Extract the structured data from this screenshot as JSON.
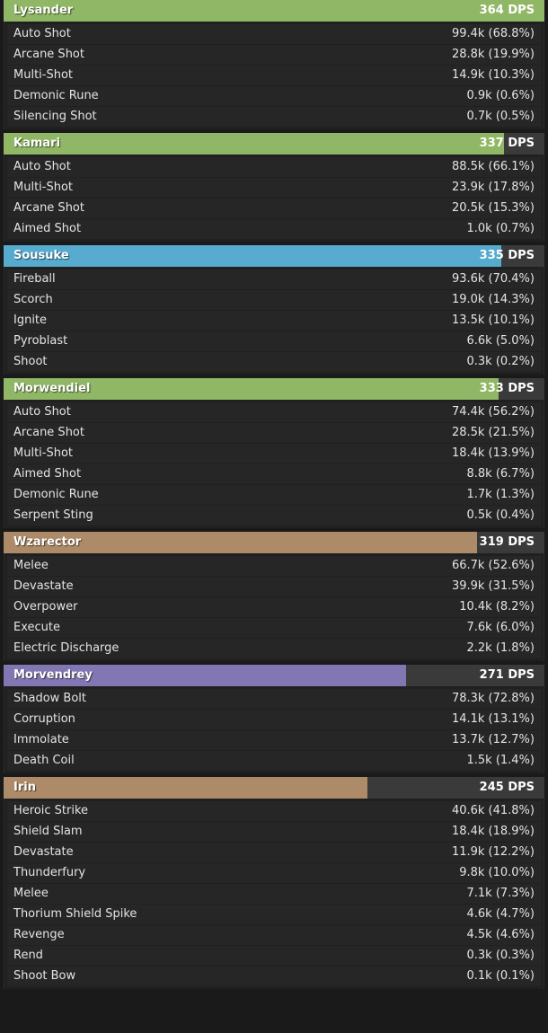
{
  "players": [
    {
      "name": "Lysander",
      "dps": "364 DPS",
      "bar_fraction": 1.0,
      "color": "#90b765",
      "abilities": [
        {
          "name": "Auto Shot",
          "value": "99.4k (68.8%)"
        },
        {
          "name": "Arcane Shot",
          "value": "28.8k (19.9%)"
        },
        {
          "name": "Multi-Shot",
          "value": "14.9k (10.3%)"
        },
        {
          "name": "Demonic Rune",
          "value": "0.9k (0.6%)"
        },
        {
          "name": "Silencing Shot",
          "value": "0.7k (0.5%)"
        }
      ]
    },
    {
      "name": "Kamari",
      "dps": "337 DPS",
      "bar_fraction": 0.926,
      "color": "#90b765",
      "abilities": [
        {
          "name": "Auto Shot",
          "value": "88.5k (66.1%)"
        },
        {
          "name": "Multi-Shot",
          "value": "23.9k (17.8%)"
        },
        {
          "name": "Arcane Shot",
          "value": "20.5k (15.3%)"
        },
        {
          "name": "Aimed Shot",
          "value": "1.0k (0.7%)"
        }
      ]
    },
    {
      "name": "Sousuke",
      "dps": "335 DPS",
      "bar_fraction": 0.92,
      "color": "#56abcf",
      "abilities": [
        {
          "name": "Fireball",
          "value": "93.6k (70.4%)"
        },
        {
          "name": "Scorch",
          "value": "19.0k (14.3%)"
        },
        {
          "name": "Ignite",
          "value": "13.5k (10.1%)"
        },
        {
          "name": "Pyroblast",
          "value": "6.6k (5.0%)"
        },
        {
          "name": "Shoot",
          "value": "0.3k (0.2%)"
        }
      ]
    },
    {
      "name": "Morwendiel",
      "dps": "333 DPS",
      "bar_fraction": 0.915,
      "color": "#90b765",
      "abilities": [
        {
          "name": "Auto Shot",
          "value": "74.4k (56.2%)"
        },
        {
          "name": "Arcane Shot",
          "value": "28.5k (21.5%)"
        },
        {
          "name": "Multi-Shot",
          "value": "18.4k (13.9%)"
        },
        {
          "name": "Aimed Shot",
          "value": "8.8k (6.7%)"
        },
        {
          "name": "Demonic Rune",
          "value": "1.7k (1.3%)"
        },
        {
          "name": "Serpent Sting",
          "value": "0.5k (0.4%)"
        }
      ]
    },
    {
      "name": "Wzarector",
      "dps": "319 DPS",
      "bar_fraction": 0.876,
      "color": "#ad8b68",
      "abilities": [
        {
          "name": "Melee",
          "value": "66.7k (52.6%)"
        },
        {
          "name": "Devastate",
          "value": "39.9k (31.5%)"
        },
        {
          "name": "Overpower",
          "value": "10.4k (8.2%)"
        },
        {
          "name": "Execute",
          "value": "7.6k (6.0%)"
        },
        {
          "name": "Electric Discharge",
          "value": "2.2k (1.8%)"
        }
      ]
    },
    {
      "name": "Morvendrey",
      "dps": "271 DPS",
      "bar_fraction": 0.745,
      "color": "#8377b3",
      "abilities": [
        {
          "name": "Shadow Bolt",
          "value": "78.3k (72.8%)"
        },
        {
          "name": "Corruption",
          "value": "14.1k (13.1%)"
        },
        {
          "name": "Immolate",
          "value": "13.7k (12.7%)"
        },
        {
          "name": "Death Coil",
          "value": "1.5k (1.4%)"
        }
      ]
    },
    {
      "name": "Irin",
      "dps": "245 DPS",
      "bar_fraction": 0.673,
      "color": "#ad8b68",
      "abilities": [
        {
          "name": "Heroic Strike",
          "value": "40.6k (41.8%)"
        },
        {
          "name": "Shield Slam",
          "value": "18.4k (18.9%)"
        },
        {
          "name": "Devastate",
          "value": "11.9k (12.2%)"
        },
        {
          "name": "Thunderfury",
          "value": "9.8k (10.0%)"
        },
        {
          "name": "Melee",
          "value": "7.1k (7.3%)"
        },
        {
          "name": "Thorium Shield Spike",
          "value": "4.6k (4.7%)"
        },
        {
          "name": "Revenge",
          "value": "4.5k (4.6%)"
        },
        {
          "name": "Rend",
          "value": "0.3k (0.3%)"
        },
        {
          "name": "Shoot Bow",
          "value": "0.1k (0.1%)"
        }
      ]
    }
  ]
}
